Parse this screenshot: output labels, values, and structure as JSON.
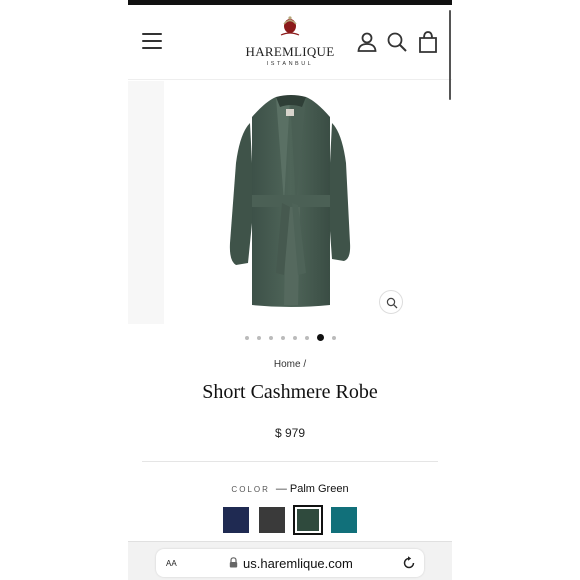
{
  "brand": {
    "name": "HAREMLIQUE",
    "sub": "ISTANBUL"
  },
  "icons": {
    "menu": "hamburger-menu-icon",
    "account": "user-icon",
    "search": "search-icon",
    "cart": "shopping-bag-icon",
    "zoom": "zoom-icon",
    "lock": "lock-icon",
    "reload": "reload-icon"
  },
  "gallery": {
    "total_images": 8,
    "active_index": 6
  },
  "breadcrumb": {
    "home": "Home",
    "separator": "/"
  },
  "product": {
    "title": "Short Cashmere Robe",
    "price": "$ 979",
    "color_label": "COLOR",
    "color_dash": "—",
    "color_value": "Palm Green",
    "swatches": [
      {
        "name": "navy",
        "color": "#1f2a52"
      },
      {
        "name": "charcoal",
        "color": "#3a3a3a"
      },
      {
        "name": "palm-green",
        "color": "#2f4a3d",
        "selected": true
      },
      {
        "name": "teal",
        "color": "#11707a"
      }
    ]
  },
  "browser": {
    "aa": "AA",
    "url": "us.haremlique.com"
  },
  "colors": {
    "robe": "#475c52",
    "brand_red": "#8b1a1a"
  }
}
